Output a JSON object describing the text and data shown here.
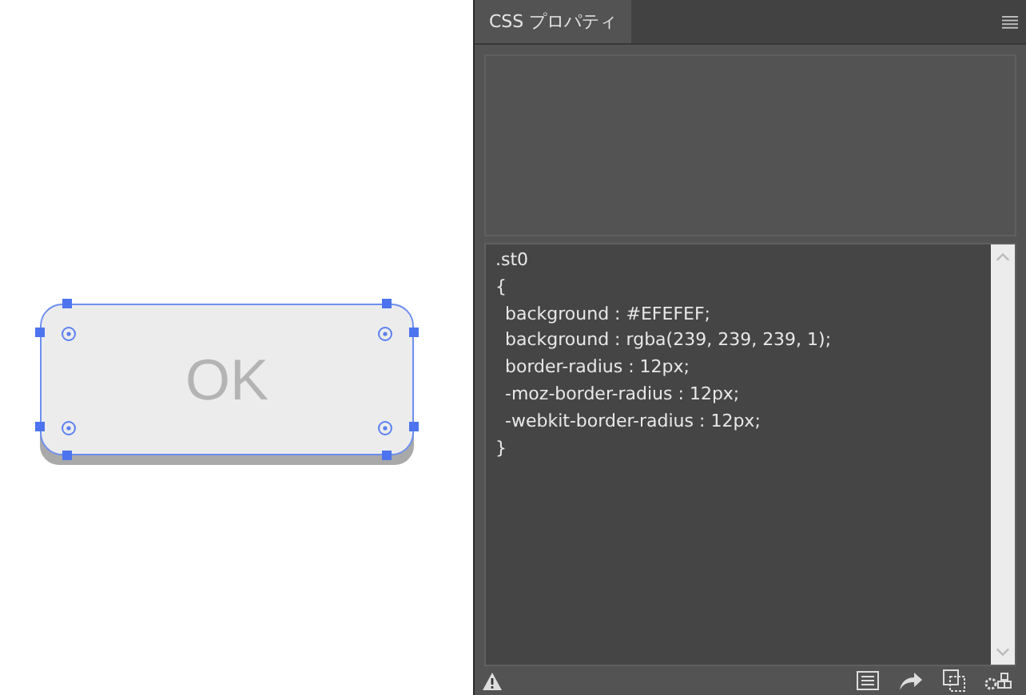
{
  "canvas": {
    "button": {
      "label": "OK",
      "selected": true
    }
  },
  "panel": {
    "tabs": [
      {
        "label": "CSS プロパティ",
        "selected": true
      }
    ],
    "code": [
      {
        "kind": "selector",
        "text": ".st0"
      },
      {
        "kind": "brace",
        "text": "{"
      },
      {
        "kind": "declaration",
        "text": "background : #EFEFEF;"
      },
      {
        "kind": "declaration",
        "text": "background : rgba(239, 239, 239, 1);"
      },
      {
        "kind": "declaration",
        "text": "border-radius : 12px;"
      },
      {
        "kind": "declaration",
        "text": "-moz-border-radius : 12px;"
      },
      {
        "kind": "declaration",
        "text": "-webkit-border-radius : 12px;"
      },
      {
        "kind": "brace",
        "text": "}"
      }
    ]
  }
}
